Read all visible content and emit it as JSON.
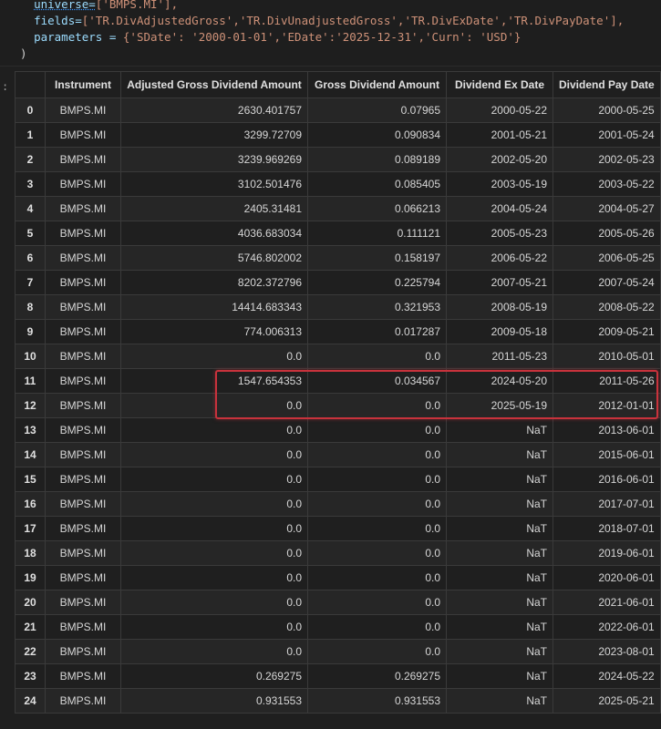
{
  "code": {
    "line1_pre": "universe=",
    "line1_val": "['BMPS.MI'],",
    "line2_pre": "fields=",
    "line2_val": "['TR.DivAdjustedGross','TR.DivUnadjustedGross','TR.DivExDate','TR.DivPayDate'],",
    "line3_pre": "parameters = ",
    "line3_val": "{'SDate': '2000-01-01','EDate':'2025-12-31','Curn': 'USD'}",
    "line4": ")"
  },
  "output_marker": ":",
  "table": {
    "columns": [
      "",
      "Instrument",
      "Adjusted Gross Dividend Amount",
      "Gross Dividend Amount",
      "Dividend Ex Date",
      "Dividend Pay Date"
    ],
    "rows": [
      [
        "0",
        "BMPS.MI",
        "2630.401757",
        "0.07965",
        "2000-05-22",
        "2000-05-25"
      ],
      [
        "1",
        "BMPS.MI",
        "3299.72709",
        "0.090834",
        "2001-05-21",
        "2001-05-24"
      ],
      [
        "2",
        "BMPS.MI",
        "3239.969269",
        "0.089189",
        "2002-05-20",
        "2002-05-23"
      ],
      [
        "3",
        "BMPS.MI",
        "3102.501476",
        "0.085405",
        "2003-05-19",
        "2003-05-22"
      ],
      [
        "4",
        "BMPS.MI",
        "2405.31481",
        "0.066213",
        "2004-05-24",
        "2004-05-27"
      ],
      [
        "5",
        "BMPS.MI",
        "4036.683034",
        "0.111121",
        "2005-05-23",
        "2005-05-26"
      ],
      [
        "6",
        "BMPS.MI",
        "5746.802002",
        "0.158197",
        "2006-05-22",
        "2006-05-25"
      ],
      [
        "7",
        "BMPS.MI",
        "8202.372796",
        "0.225794",
        "2007-05-21",
        "2007-05-24"
      ],
      [
        "8",
        "BMPS.MI",
        "14414.683343",
        "0.321953",
        "2008-05-19",
        "2008-05-22"
      ],
      [
        "9",
        "BMPS.MI",
        "774.006313",
        "0.017287",
        "2009-05-18",
        "2009-05-21"
      ],
      [
        "10",
        "BMPS.MI",
        "0.0",
        "0.0",
        "2011-05-23",
        "2010-05-01"
      ],
      [
        "11",
        "BMPS.MI",
        "1547.654353",
        "0.034567",
        "2024-05-20",
        "2011-05-26"
      ],
      [
        "12",
        "BMPS.MI",
        "0.0",
        "0.0",
        "2025-05-19",
        "2012-01-01"
      ],
      [
        "13",
        "BMPS.MI",
        "0.0",
        "0.0",
        "NaT",
        "2013-06-01"
      ],
      [
        "14",
        "BMPS.MI",
        "0.0",
        "0.0",
        "NaT",
        "2015-06-01"
      ],
      [
        "15",
        "BMPS.MI",
        "0.0",
        "0.0",
        "NaT",
        "2016-06-01"
      ],
      [
        "16",
        "BMPS.MI",
        "0.0",
        "0.0",
        "NaT",
        "2017-07-01"
      ],
      [
        "17",
        "BMPS.MI",
        "0.0",
        "0.0",
        "NaT",
        "2018-07-01"
      ],
      [
        "18",
        "BMPS.MI",
        "0.0",
        "0.0",
        "NaT",
        "2019-06-01"
      ],
      [
        "19",
        "BMPS.MI",
        "0.0",
        "0.0",
        "NaT",
        "2020-06-01"
      ],
      [
        "20",
        "BMPS.MI",
        "0.0",
        "0.0",
        "NaT",
        "2021-06-01"
      ],
      [
        "21",
        "BMPS.MI",
        "0.0",
        "0.0",
        "NaT",
        "2022-06-01"
      ],
      [
        "22",
        "BMPS.MI",
        "0.0",
        "0.0",
        "NaT",
        "2023-08-01"
      ],
      [
        "23",
        "BMPS.MI",
        "0.269275",
        "0.269275",
        "NaT",
        "2024-05-22"
      ],
      [
        "24",
        "BMPS.MI",
        "0.931553",
        "0.931553",
        "NaT",
        "2025-05-21"
      ]
    ]
  },
  "colors": {
    "highlight": "#c8323c",
    "string": "#ce9178",
    "variable": "#9cdcfe"
  }
}
